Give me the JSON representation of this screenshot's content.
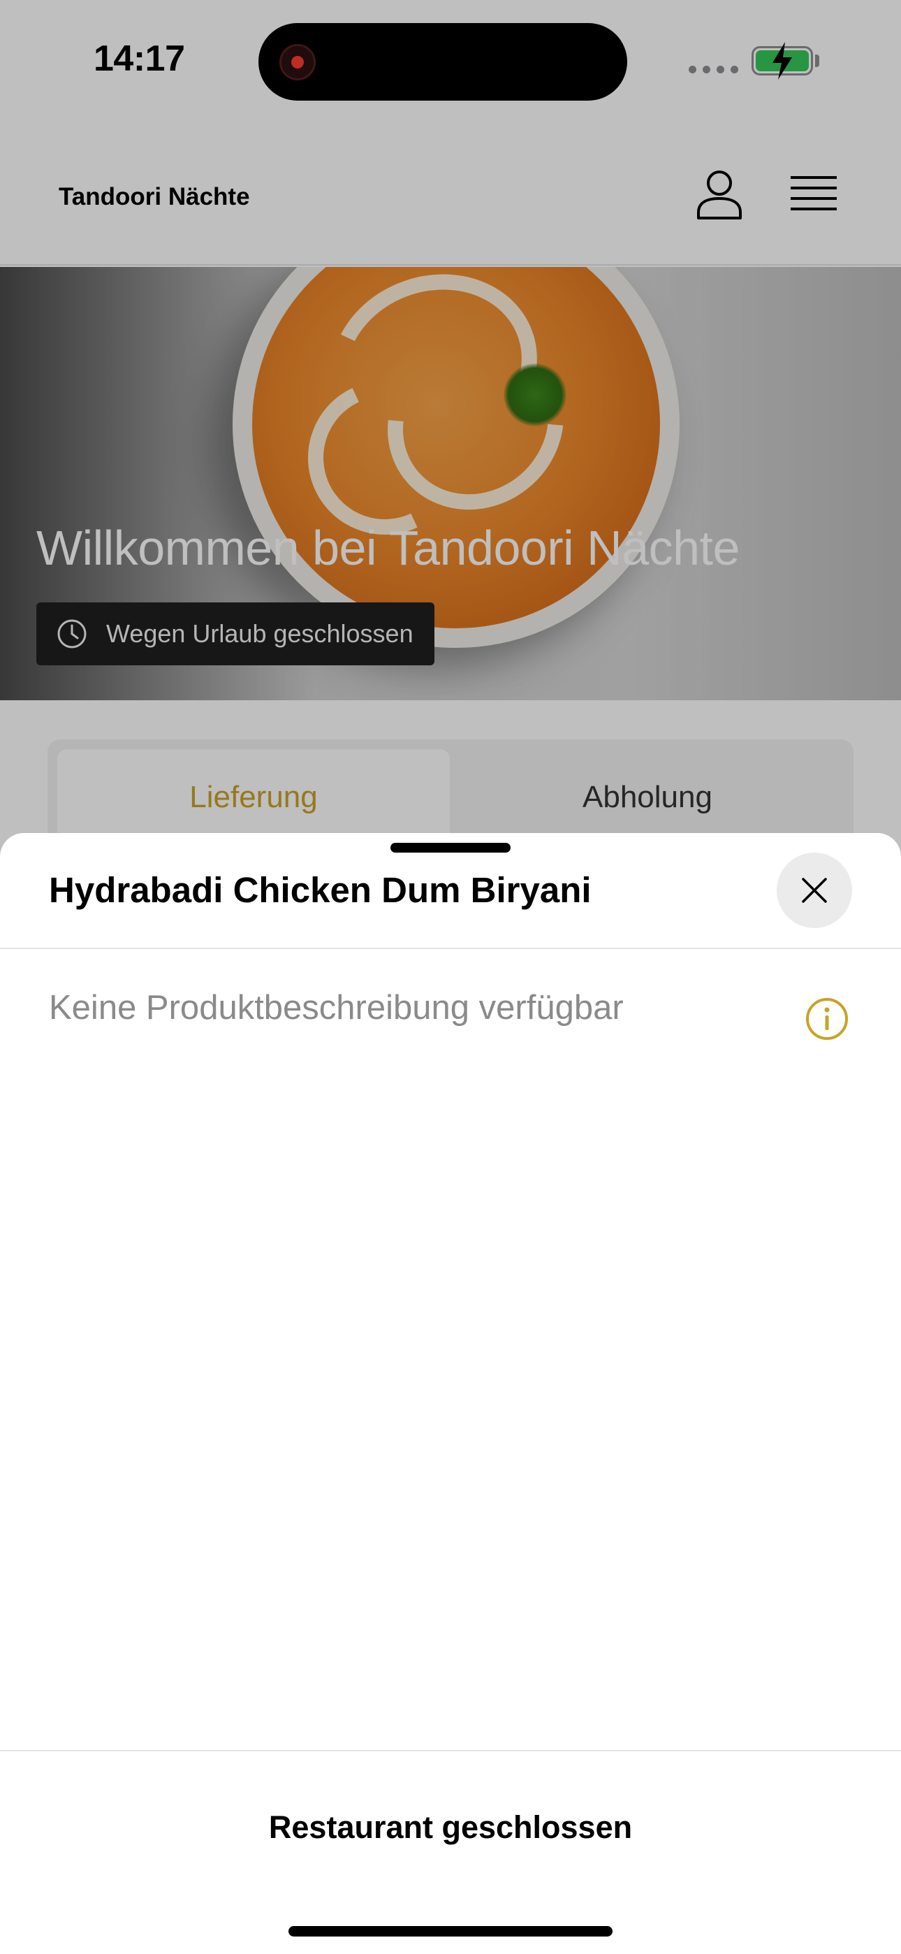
{
  "status_bar": {
    "time": "14:17",
    "icons": [
      "screen-recording-icon",
      "signal-icon",
      "battery-charging-icon"
    ],
    "battery_color": "#34c759",
    "record_color": "#ff3b30"
  },
  "header": {
    "brand": "Tandoori Nächte",
    "icons": [
      "profile-icon",
      "hamburger-menu-icon"
    ]
  },
  "hero": {
    "title": "Willkommen bei Tandoori Nächte",
    "closed_badge": "Wegen Urlaub geschlossen",
    "closed_badge_icon": "clock-icon"
  },
  "order_tabs": {
    "delivery": "Lieferung",
    "pickup": "Abholung",
    "selected": "delivery",
    "accent_color": "#c9a227"
  },
  "sheet": {
    "title": "Hydrabadi Chicken Dum Biryani",
    "close_icon": "close-icon",
    "description": "Keine Produktbeschreibung verfügbar",
    "info_icon": "info-icon",
    "action_label": "Restaurant geschlossen"
  }
}
